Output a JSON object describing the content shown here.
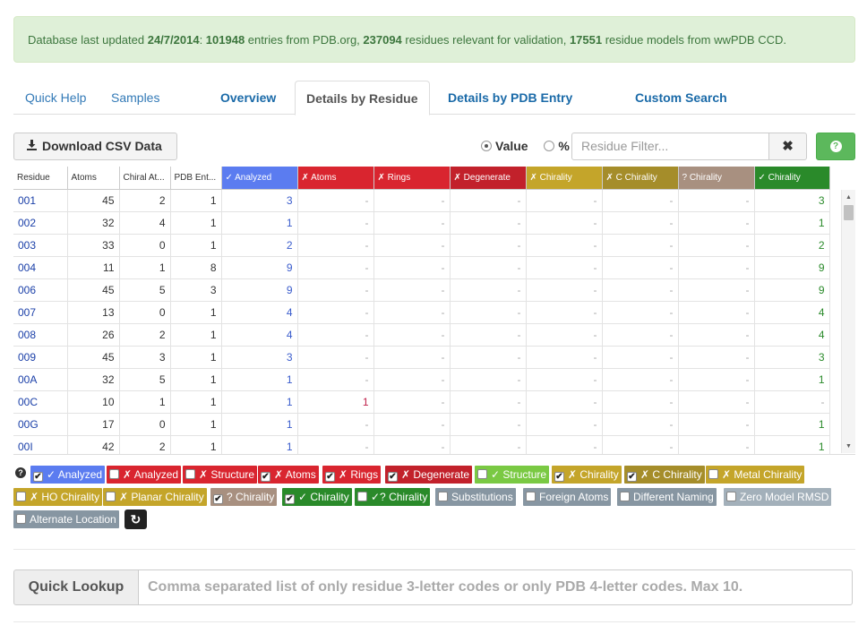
{
  "status": {
    "prefix": "Database last updated ",
    "date": "24/7/2014",
    "sep": ": ",
    "entries": "101948",
    "entries_text": " entries from PDB.org, ",
    "residues": "237094",
    "residues_text": " residues relevant for validation, ",
    "models": "17551",
    "models_text": " residue models from wwPDB CCD."
  },
  "tabs": [
    {
      "label": "Quick Help"
    },
    {
      "label": "Samples"
    },
    {
      "label": "Overview"
    },
    {
      "label": "Details by Residue"
    },
    {
      "label": "Details by PDB Entry"
    },
    {
      "label": "Custom Search"
    }
  ],
  "toolbar": {
    "download_label": "Download CSV Data",
    "value_label": "Value",
    "percent_label": "%",
    "filter_placeholder": "Residue Filter...",
    "clear_label": "✖",
    "help_label": "?"
  },
  "table": {
    "columns": [
      {
        "label": "Residue",
        "color": "#ffffff",
        "text": "#333333"
      },
      {
        "label": "Atoms",
        "color": "#ffffff",
        "text": "#333333"
      },
      {
        "label": "Chiral At...",
        "color": "#ffffff",
        "text": "#333333"
      },
      {
        "label": "PDB Ent...",
        "color": "#ffffff",
        "text": "#333333"
      },
      {
        "label": "✓ Analyzed",
        "color": "#5b7cf0",
        "text": "#ffffff"
      },
      {
        "label": "✗ Atoms",
        "color": "#d9252f",
        "text": "#ffffff"
      },
      {
        "label": "✗ Rings",
        "color": "#d9252f",
        "text": "#ffffff"
      },
      {
        "label": "✗ Degenerate",
        "color": "#c2212b",
        "text": "#ffffff"
      },
      {
        "label": "✗ Chirality",
        "color": "#c4a52a",
        "text": "#ffffff"
      },
      {
        "label": "✗ C Chirality",
        "color": "#a58d2a",
        "text": "#ffffff"
      },
      {
        "label": "? Chirality",
        "color": "#a89080",
        "text": "#ffffff"
      },
      {
        "label": "✓ Chirality",
        "color": "#2a8a2a",
        "text": "#ffffff"
      }
    ],
    "rows": [
      [
        "001",
        "45",
        "2",
        "1",
        "3",
        "-",
        "-",
        "-",
        "-",
        "-",
        "-",
        "3"
      ],
      [
        "002",
        "32",
        "4",
        "1",
        "1",
        "-",
        "-",
        "-",
        "-",
        "-",
        "-",
        "1"
      ],
      [
        "003",
        "33",
        "0",
        "1",
        "2",
        "-",
        "-",
        "-",
        "-",
        "-",
        "-",
        "2"
      ],
      [
        "004",
        "11",
        "1",
        "8",
        "9",
        "-",
        "-",
        "-",
        "-",
        "-",
        "-",
        "9"
      ],
      [
        "006",
        "45",
        "5",
        "3",
        "9",
        "-",
        "-",
        "-",
        "-",
        "-",
        "-",
        "9"
      ],
      [
        "007",
        "13",
        "0",
        "1",
        "4",
        "-",
        "-",
        "-",
        "-",
        "-",
        "-",
        "4"
      ],
      [
        "008",
        "26",
        "2",
        "1",
        "4",
        "-",
        "-",
        "-",
        "-",
        "-",
        "-",
        "4"
      ],
      [
        "009",
        "45",
        "3",
        "1",
        "3",
        "-",
        "-",
        "-",
        "-",
        "-",
        "-",
        "3"
      ],
      [
        "00A",
        "32",
        "5",
        "1",
        "1",
        "-",
        "-",
        "-",
        "-",
        "-",
        "-",
        "1"
      ],
      [
        "00C",
        "10",
        "1",
        "1",
        "1",
        "1",
        "-",
        "-",
        "-",
        "-",
        "-",
        "-"
      ],
      [
        "00G",
        "17",
        "0",
        "1",
        "1",
        "-",
        "-",
        "-",
        "-",
        "-",
        "-",
        "1"
      ],
      [
        "00I",
        "42",
        "2",
        "1",
        "1",
        "-",
        "-",
        "-",
        "-",
        "-",
        "-",
        "1"
      ]
    ]
  },
  "legend": [
    {
      "label": "✓ Analyzed",
      "checked": true,
      "color": "#5b7cf0"
    },
    {
      "label": "✗ Analyzed",
      "checked": false,
      "color": "#d9252f"
    },
    {
      "label": "✗ Structure",
      "checked": false,
      "color": "#d9252f"
    },
    {
      "label": "✗ Atoms",
      "checked": true,
      "color": "#d9252f"
    },
    {
      "label": "✗ Rings",
      "checked": true,
      "color": "#d9252f"
    },
    {
      "label": "✗ Degenerate",
      "checked": true,
      "color": "#c2212b"
    },
    {
      "label": "✓ Structure",
      "checked": false,
      "color": "#7ac943"
    },
    {
      "label": "✗ Chirality",
      "checked": true,
      "color": "#c4a52a"
    },
    {
      "label": "✗ C Chirality",
      "checked": true,
      "color": "#a58d2a"
    },
    {
      "label": "✗ Metal Chirality",
      "checked": false,
      "color": "#c4a52a"
    },
    {
      "label": "✗ HO Chirality",
      "checked": false,
      "color": "#c4a52a"
    },
    {
      "label": "✗ Planar Chirality",
      "checked": false,
      "color": "#c4a52a"
    },
    {
      "label": "? Chirality",
      "checked": true,
      "color": "#a89080"
    },
    {
      "label": "✓ Chirality",
      "checked": true,
      "color": "#2a8a2a"
    },
    {
      "label": "✓? Chirality",
      "checked": false,
      "color": "#2a8a2a"
    },
    {
      "label": "Substitutions",
      "checked": false,
      "color": "#8796a2"
    },
    {
      "label": "Foreign Atoms",
      "checked": false,
      "color": "#8796a2"
    },
    {
      "label": "Different Naming",
      "checked": false,
      "color": "#8796a2"
    },
    {
      "label": "Zero Model RMSD",
      "checked": false,
      "color": "#a3b0ba"
    },
    {
      "label": "Alternate Location",
      "checked": false,
      "color": "#8796a2"
    }
  ],
  "lookup": {
    "label": "Quick Lookup",
    "placeholder": "Comma separated list of only residue 3-letter codes or only PDB 4-letter codes. Max 10."
  }
}
